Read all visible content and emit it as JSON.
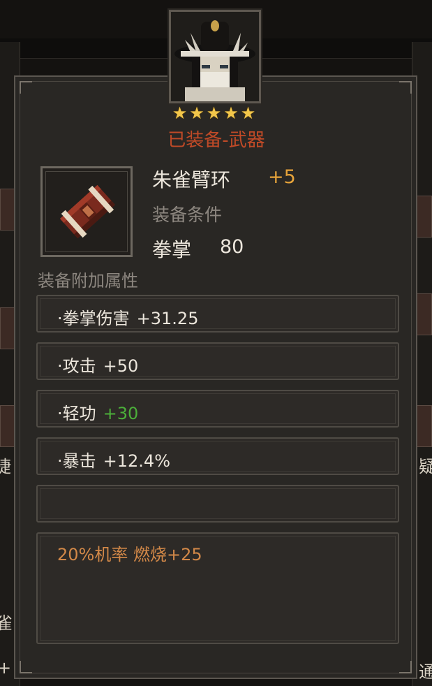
{
  "portrait": {
    "icon": "character-portrait-icon"
  },
  "stars": {
    "count": 5,
    "glyphs": "★★★★★",
    "color": "#f2c64a"
  },
  "equipped_label": "已装备-武器",
  "item": {
    "icon": "bracer-icon",
    "name": "朱雀臂环",
    "plus": "+5",
    "requirement_label": "装备条件",
    "requirement_stat": "拳掌",
    "requirement_value": "80"
  },
  "attributes": {
    "title": "装备附加属性",
    "rows": [
      {
        "name": "·拳掌伤害",
        "value": "+31.25",
        "color": "#ece6dc"
      },
      {
        "name": "·攻击",
        "value": "+50",
        "color": "#ece6dc"
      },
      {
        "name": "·轻功",
        "value": "+30",
        "color": "#4caf3a"
      },
      {
        "name": "·暴击",
        "value": "+12.4%",
        "color": "#ece6dc"
      },
      {
        "name": "",
        "value": "",
        "color": "#ece6dc"
      }
    ]
  },
  "special_effect": "20%机率 燃烧+25",
  "edge_chars": {
    "left_1": "捷",
    "left_2": "雀",
    "left_3": "+",
    "right_1": "疑",
    "right_2": "通"
  },
  "colors": {
    "accent_red": "#c04a27",
    "plus_orange": "#e6a33a",
    "effect_orange": "#d28848"
  }
}
